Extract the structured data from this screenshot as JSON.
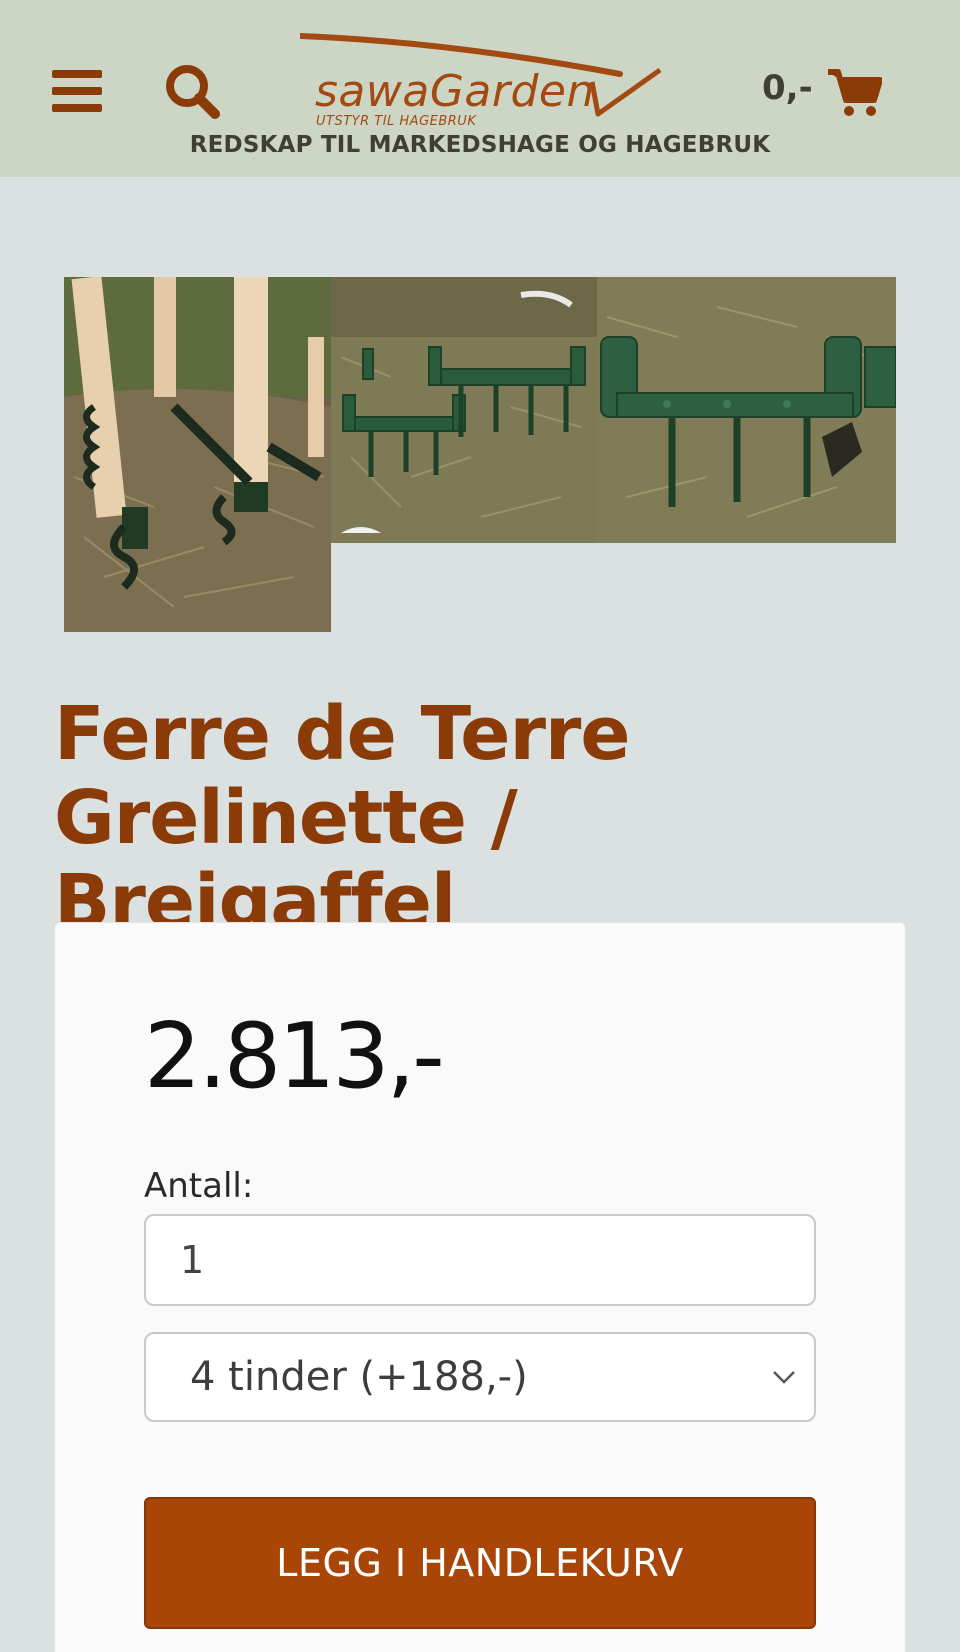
{
  "header": {
    "logo_text": "sawaGarden",
    "logo_subtitle": "UTSTYR TIL HAGEBRUK",
    "tagline": "REDSKAP TIL MARKEDSHAGE OG HAGEBRUK",
    "cart_total": "0,-",
    "icons": [
      "hamburger-menu-icon",
      "search-icon",
      "shopping-cart-icon"
    ]
  },
  "product": {
    "title_line1": "Ferre de Terre",
    "title_line2": "Grelinette / Breigaffel",
    "price": "2.813,-",
    "quantity_label": "Antall:",
    "quantity_value": "1",
    "variant_selected": "4 tinder (+188,-)",
    "add_to_cart_label": "LEGG I HANDLEKURV"
  },
  "colors": {
    "header_bg": "#cdd5c4",
    "page_bg": "#dbe0e1",
    "brand_brown": "#8a3b08",
    "button_bg": "#a84507"
  }
}
